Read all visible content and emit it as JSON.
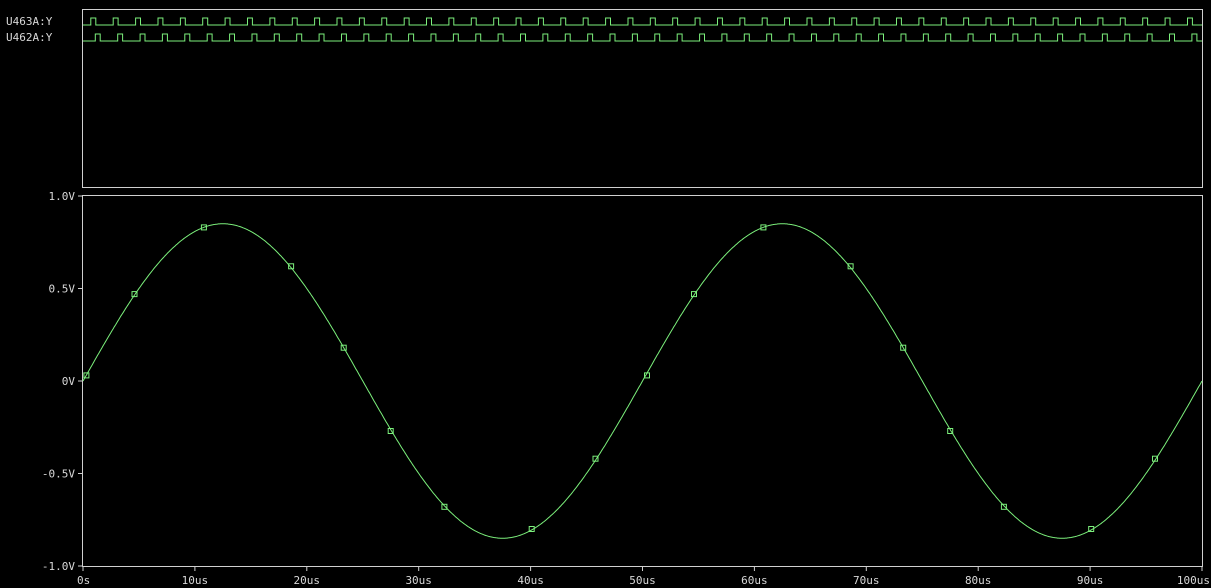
{
  "colors": {
    "background": "#000000",
    "trace": "#7cf07c",
    "frame": "#d0d0d0",
    "text": "#d8d8d8"
  },
  "chart_data": [
    {
      "type": "line",
      "subtype": "digital",
      "series": [
        {
          "name": "U463A:Y",
          "period_us": 2.0,
          "values": [
            0,
            1
          ]
        },
        {
          "name": "U462A:Y",
          "period_us": 2.0,
          "values": [
            0,
            1
          ]
        }
      ],
      "xlim": [
        0,
        100
      ]
    },
    {
      "type": "line",
      "x_unit": "us",
      "xlim": [
        0,
        100
      ],
      "ylim": [
        -1.0,
        1.0
      ],
      "x_ticks": [
        "0s",
        "10us",
        "20us",
        "30us",
        "40us",
        "50us",
        "60us",
        "70us",
        "80us",
        "90us",
        "100us"
      ],
      "y_ticks": [
        "1.0V",
        "0.5V",
        "0V",
        "-0.5V",
        "-1.0V"
      ],
      "series": [
        {
          "amplitude": 0.85,
          "period_us": 50,
          "x": [
            0.3,
            4.6,
            10.8,
            18.6,
            23.3,
            27.5,
            32.3,
            40.1,
            45.8,
            50.4,
            54.6,
            60.8,
            68.6,
            73.3,
            77.5,
            82.3,
            90.1,
            95.8
          ],
          "y": [
            0.03,
            0.47,
            0.83,
            0.62,
            0.18,
            -0.27,
            -0.68,
            -0.8,
            -0.42,
            0.03,
            0.47,
            0.83,
            0.62,
            0.18,
            -0.27,
            -0.68,
            -0.8,
            -0.42
          ]
        }
      ]
    }
  ]
}
